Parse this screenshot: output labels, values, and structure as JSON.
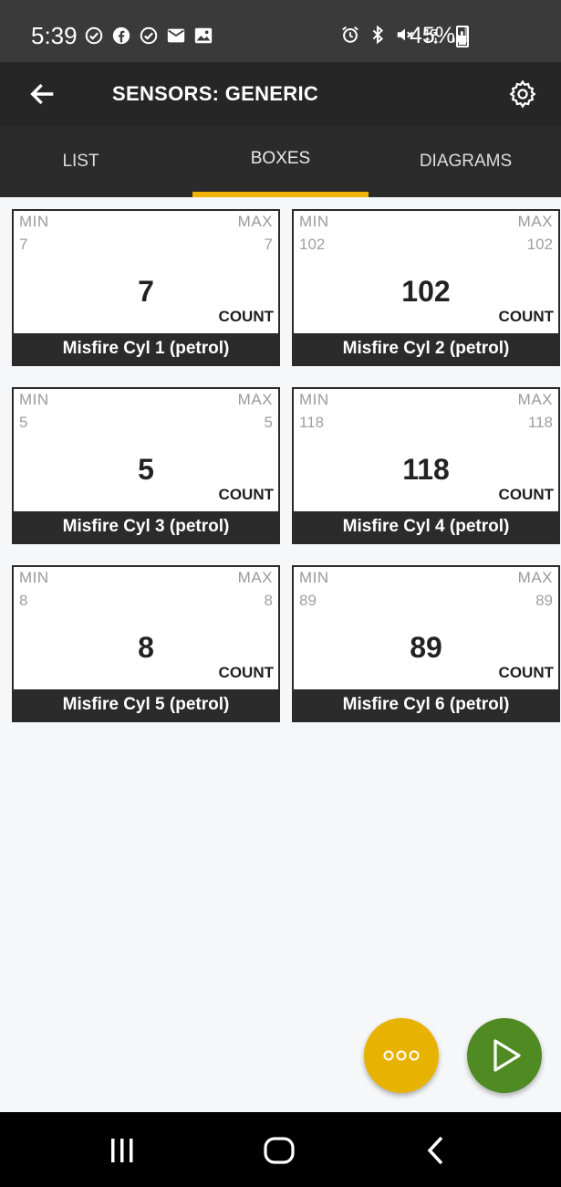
{
  "status": {
    "time": "5:39",
    "battery": "45%",
    "icons_left": [
      "check-circle-icon",
      "facebook-icon",
      "check-circle-icon",
      "mail-icon",
      "image-icon"
    ],
    "icons_right": [
      "alarm-icon",
      "bluetooth-icon",
      "mute-icon",
      "4g-lte-icon",
      "signal-icon"
    ]
  },
  "appbar": {
    "title": "SENSORS: GENERIC"
  },
  "tabs": [
    {
      "label": "LIST",
      "active": false
    },
    {
      "label": "BOXES",
      "active": true
    },
    {
      "label": "DIAGRAMS",
      "active": false
    }
  ],
  "cards": [
    {
      "min_label": "MIN",
      "max_label": "MAX",
      "min": "7",
      "max": "7",
      "value": "7",
      "unit": "COUNT",
      "name": "Misfire Cyl 1 (petrol)"
    },
    {
      "min_label": "MIN",
      "max_label": "MAX",
      "min": "102",
      "max": "102",
      "value": "102",
      "unit": "COUNT",
      "name": "Misfire Cyl 2 (petrol)"
    },
    {
      "min_label": "MIN",
      "max_label": "MAX",
      "min": "5",
      "max": "5",
      "value": "5",
      "unit": "COUNT",
      "name": "Misfire Cyl 3 (petrol)"
    },
    {
      "min_label": "MIN",
      "max_label": "MAX",
      "min": "118",
      "max": "118",
      "value": "118",
      "unit": "COUNT",
      "name": "Misfire Cyl 4 (petrol)"
    },
    {
      "min_label": "MIN",
      "max_label": "MAX",
      "min": "8",
      "max": "8",
      "value": "8",
      "unit": "COUNT",
      "name": "Misfire Cyl 5 (petrol)"
    },
    {
      "min_label": "MIN",
      "max_label": "MAX",
      "min": "89",
      "max": "89",
      "value": "89",
      "unit": "COUNT",
      "name": "Misfire Cyl 6 (petrol)"
    }
  ],
  "fabs": {
    "more_icon": "more-dots-icon",
    "play_icon": "play-icon"
  },
  "colors": {
    "accent": "#f0b400",
    "fab_more": "#e8b300",
    "fab_play": "#4f8a22",
    "appbar": "#262626",
    "card_label_bg": "#2b2b2b"
  },
  "navbar": {
    "icons": [
      "recent-apps-icon",
      "home-icon",
      "back-nav-icon"
    ]
  }
}
